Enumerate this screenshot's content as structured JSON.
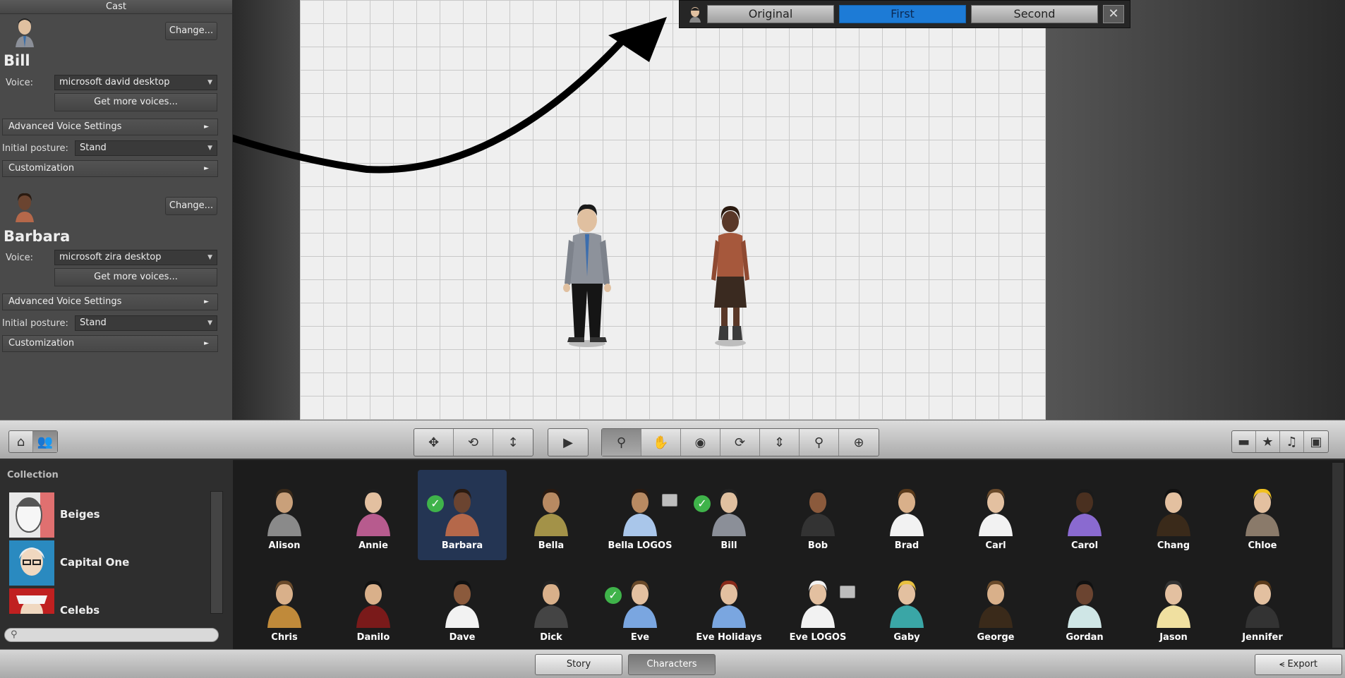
{
  "cast": {
    "header": "Cast",
    "characters": [
      {
        "name": "Bill",
        "change_label": "Change...",
        "voice_label": "Voice:",
        "voice_value": "microsoft david desktop",
        "more_voices_label": "Get more voices...",
        "advanced_label": "Advanced Voice Settings",
        "posture_label": "Initial posture:",
        "posture_value": "Stand",
        "customization_label": "Customization"
      },
      {
        "name": "Barbara",
        "change_label": "Change...",
        "voice_label": "Voice:",
        "voice_value": "microsoft zira desktop",
        "more_voices_label": "Get more voices...",
        "advanced_label": "Advanced Voice Settings",
        "posture_label": "Initial posture:",
        "posture_value": "Stand",
        "customization_label": "Customization"
      }
    ]
  },
  "compare_bar": {
    "options": [
      "Original",
      "First",
      "Second"
    ],
    "active": "First",
    "close_icon": "close-icon"
  },
  "toolbar": {
    "left_icons": [
      "home-icon",
      "people-icon"
    ],
    "group1_icons": [
      "move-icon",
      "rotate-icon",
      "vertical-move-icon"
    ],
    "play_icon": "play-icon",
    "group2_icons": [
      "pose-icon",
      "hand-icon",
      "eye-icon",
      "refresh-icon",
      "align-icon",
      "zoom-icon",
      "zoom-fit-icon"
    ],
    "right_icons": [
      "camera-icon",
      "camera-star-icon",
      "music-icon",
      "media-icon"
    ]
  },
  "collection": {
    "title": "Collection",
    "items": [
      {
        "label": "Beiges"
      },
      {
        "label": "Capital One"
      },
      {
        "label": "Celebs"
      }
    ],
    "search_placeholder": ""
  },
  "character_grid": {
    "rows": [
      [
        {
          "name": "Alison",
          "checked": false,
          "pic": false,
          "skin": "#c9a07a",
          "shirt": "#8a8a8a",
          "hair": "#3a2a1a"
        },
        {
          "name": "Annie",
          "checked": false,
          "pic": false,
          "skin": "#e3c0a0",
          "shirt": "#b75b8e",
          "hair": "#1e1e1e"
        },
        {
          "name": "Barbara",
          "checked": true,
          "pic": false,
          "selected": true,
          "skin": "#6b4430",
          "shirt": "#b5684a",
          "hair": "#2a1a10"
        },
        {
          "name": "Bella",
          "checked": false,
          "pic": false,
          "skin": "#b88a62",
          "shirt": "#a39248",
          "hair": "#2a1a10"
        },
        {
          "name": "Bella LOGOS",
          "checked": false,
          "pic": true,
          "skin": "#b88a62",
          "shirt": "#a9c6ea",
          "hair": "#2a1a10"
        },
        {
          "name": "Bill",
          "checked": true,
          "pic": false,
          "skin": "#e0c0a0",
          "shirt": "#8b8f98",
          "hair": "#222"
        },
        {
          "name": "Bob",
          "checked": false,
          "pic": false,
          "skin": "#8b5a3c",
          "shirt": "#333",
          "hair": "#1a1a1a"
        },
        {
          "name": "Brad",
          "checked": false,
          "pic": false,
          "skin": "#d9b08a",
          "shirt": "#f2f2f2",
          "hair": "#5a3a1a"
        },
        {
          "name": "Carl",
          "checked": false,
          "pic": false,
          "skin": "#e3c0a0",
          "shirt": "#f2f2f2",
          "hair": "#6a4a2a"
        },
        {
          "name": "Carol",
          "checked": false,
          "pic": false,
          "skin": "#4a3020",
          "shirt": "#8a6ad0",
          "hair": "#1a1a1a"
        },
        {
          "name": "Chang",
          "checked": false,
          "pic": false,
          "skin": "#e3c0a0",
          "shirt": "#3a2a1a",
          "hair": "#111"
        },
        {
          "name": "Chloe",
          "checked": false,
          "pic": false,
          "skin": "#e3c0a0",
          "shirt": "#8a7a6a",
          "hair": "#f0c020"
        }
      ],
      [
        {
          "name": "Chris",
          "checked": false,
          "pic": false,
          "skin": "#d9b08a",
          "shirt": "#c08a3a",
          "hair": "#6a4a2a"
        },
        {
          "name": "Danilo",
          "checked": false,
          "pic": false,
          "skin": "#d9b08a",
          "shirt": "#7a1a1a",
          "hair": "#111"
        },
        {
          "name": "Dave",
          "checked": false,
          "pic": false,
          "skin": "#8b5a3c",
          "shirt": "#f2f2f2",
          "hair": "#111"
        },
        {
          "name": "Dick",
          "checked": false,
          "pic": false,
          "skin": "#d9b08a",
          "shirt": "#444",
          "hair": "#222"
        },
        {
          "name": "Eve",
          "checked": true,
          "pic": false,
          "skin": "#e3c0a0",
          "shirt": "#7aa6e0",
          "hair": "#6a4a2a"
        },
        {
          "name": "Eve Holidays",
          "checked": false,
          "pic": false,
          "skin": "#e3c0a0",
          "shirt": "#7aa6e0",
          "hair": "#8a2a1a"
        },
        {
          "name": "Eve LOGOS",
          "checked": false,
          "pic": true,
          "skin": "#e3c0a0",
          "shirt": "#f2f2f2",
          "hair": "#f2f2f2"
        },
        {
          "name": "Gaby",
          "checked": false,
          "pic": false,
          "skin": "#e3c0a0",
          "shirt": "#3aa6a6",
          "hair": "#e8c040"
        },
        {
          "name": "George",
          "checked": false,
          "pic": false,
          "skin": "#d9b08a",
          "shirt": "#3a2a1a",
          "hair": "#6a4a2a"
        },
        {
          "name": "Gordan",
          "checked": false,
          "pic": false,
          "skin": "#6b4430",
          "shirt": "#cfe6e6",
          "hair": "#111"
        },
        {
          "name": "Jason",
          "checked": false,
          "pic": false,
          "skin": "#e3c0a0",
          "shirt": "#f0e0a0",
          "hair": "#333"
        },
        {
          "name": "Jennifer",
          "checked": false,
          "pic": false,
          "skin": "#e3c0a0",
          "shirt": "#333",
          "hair": "#5a3a1a"
        }
      ]
    ]
  },
  "bottom_bar": {
    "tabs": [
      "Story",
      "Characters"
    ],
    "active_tab": "Characters",
    "export_label": "Export",
    "export_icon": "share-icon"
  }
}
